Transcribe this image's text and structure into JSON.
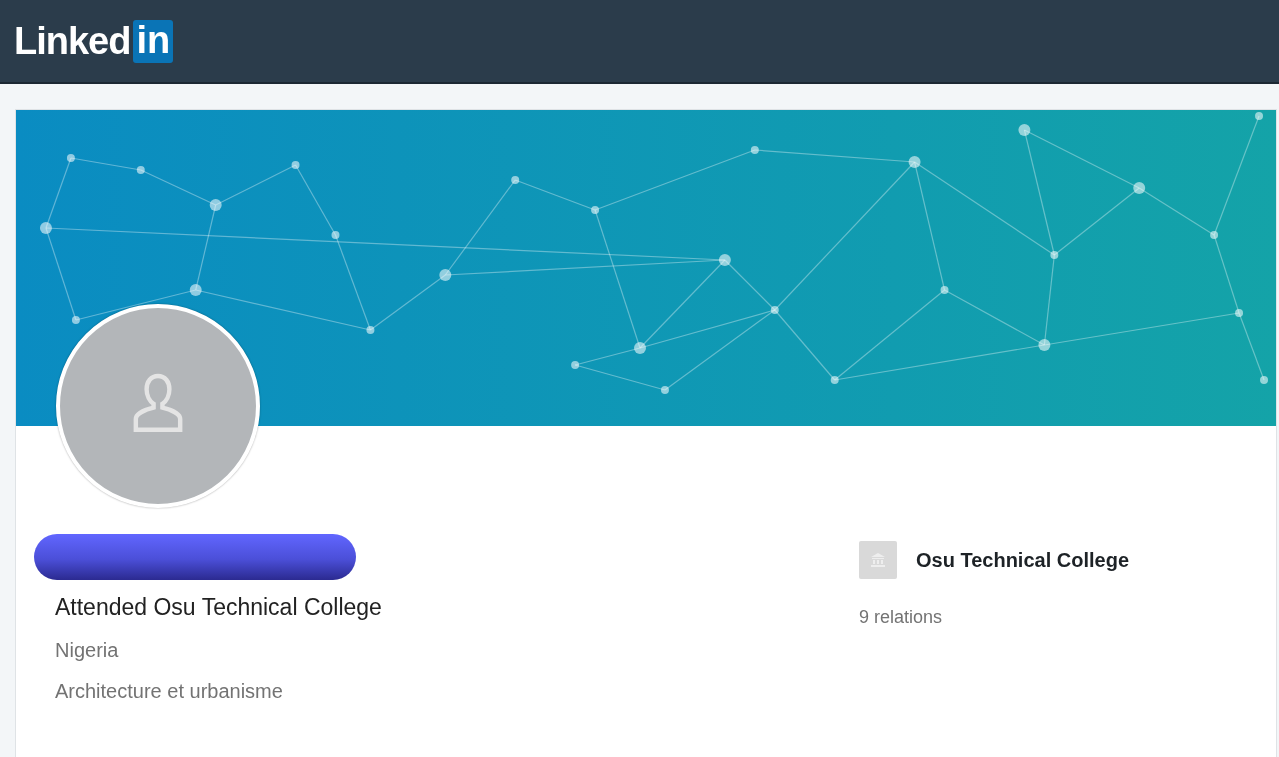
{
  "header": {
    "logo_word": "Linked",
    "logo_badge": "in"
  },
  "profile": {
    "name_redacted": true,
    "headline": "Attended Osu Technical College",
    "location": "Nigeria",
    "field": "Architecture et urbanisme"
  },
  "school": {
    "name": "Osu Technical College",
    "relations": "9 relations"
  }
}
